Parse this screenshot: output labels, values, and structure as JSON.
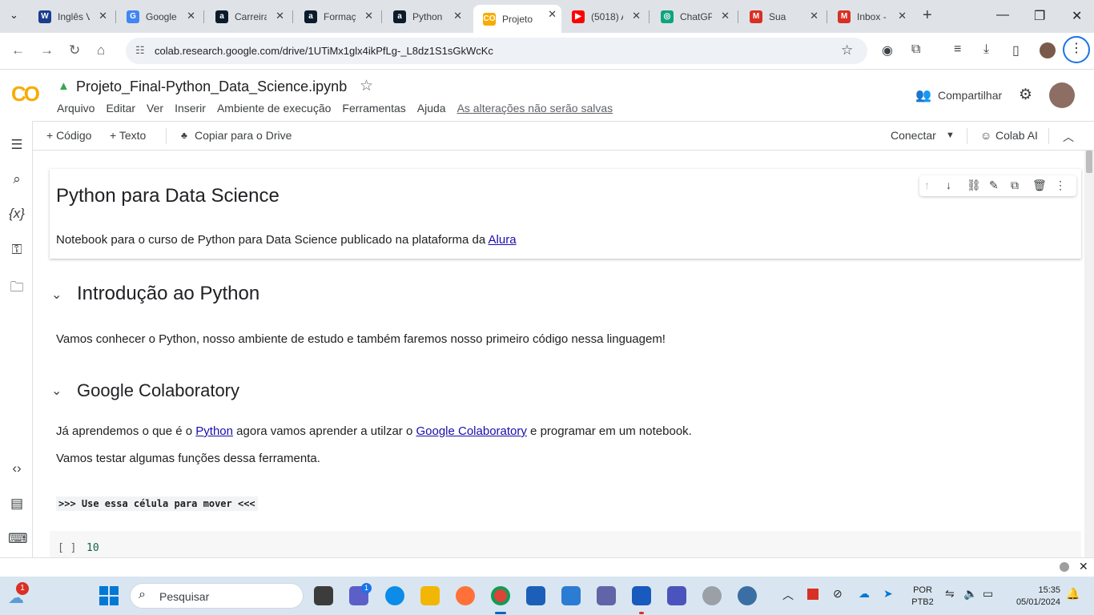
{
  "browser": {
    "tabs": [
      {
        "title": "Inglês V",
        "favicon": "W",
        "color": "#1a3e8c"
      },
      {
        "title": "Google",
        "favicon": "G",
        "color": "#4285f4"
      },
      {
        "title": "Carreira",
        "favicon": "a",
        "color": "#0b1b2b"
      },
      {
        "title": "Formaç",
        "favicon": "a",
        "color": "#0b1b2b"
      },
      {
        "title": "Python",
        "favicon": "a",
        "color": "#0b1b2b"
      },
      {
        "title": "Projeto",
        "favicon": "CO",
        "color": "#f9ab00",
        "active": true
      },
      {
        "title": "(5018) A",
        "favicon": "▶",
        "color": "#ff0000"
      },
      {
        "title": "ChatGP",
        "favicon": "◎",
        "color": "#10a37f"
      },
      {
        "title": "Sua",
        "favicon": "M",
        "color": "#d93025"
      },
      {
        "title": "Inbox -",
        "favicon": "M",
        "color": "#d93025"
      }
    ],
    "new_tab": "+",
    "url": "colab.research.google.com/drive/1UTiMx1glx4ikPfLg-_L8dz1S1sGkWcKc"
  },
  "colab": {
    "logo": "CO",
    "title": "Projeto_Final-Python_Data_Science.ipynb",
    "menu": [
      "Arquivo",
      "Editar",
      "Ver",
      "Inserir",
      "Ambiente de execução",
      "Ferramentas",
      "Ajuda"
    ],
    "unsaved": "As alterações não serão salvas",
    "share": "Compartilhar",
    "toolbar": {
      "code": "+ Código",
      "text": "+ Texto",
      "copy": "Copiar para o Drive",
      "connect": "Conectar",
      "ai": "Colab AI"
    }
  },
  "cells": {
    "title": "Python para Data Science",
    "subtitle_pre": "Notebook para o curso de Python para Data Science publicado na plataforma da ",
    "subtitle_link": "Alura",
    "section1": "Introdução ao Python",
    "section1_text": "Vamos conhecer o Python, nosso ambiente de estudo e também faremos nosso primeiro código nessa linguagem!",
    "section2": "Google Colaboratory",
    "s2_pre": "Já aprendemos o que é o ",
    "s2_link1": "Python",
    "s2_mid": " agora vamos aprender a utilzar o ",
    "s2_link2": "Google Colaboratory",
    "s2_post": " e programar em um notebook.",
    "s2_line2": "Vamos testar algumas funções dessa ferramenta.",
    "move_cell": ">>> Use essa célula para mover <<<",
    "code_prompt": "[ ]",
    "code": "10"
  },
  "taskbar": {
    "search": "Pesquisar",
    "lang": "POR",
    "layout": "PTB2",
    "time": "15:35",
    "date": "05/01/2024",
    "weather_badge": "1",
    "chat_badge": "1"
  }
}
